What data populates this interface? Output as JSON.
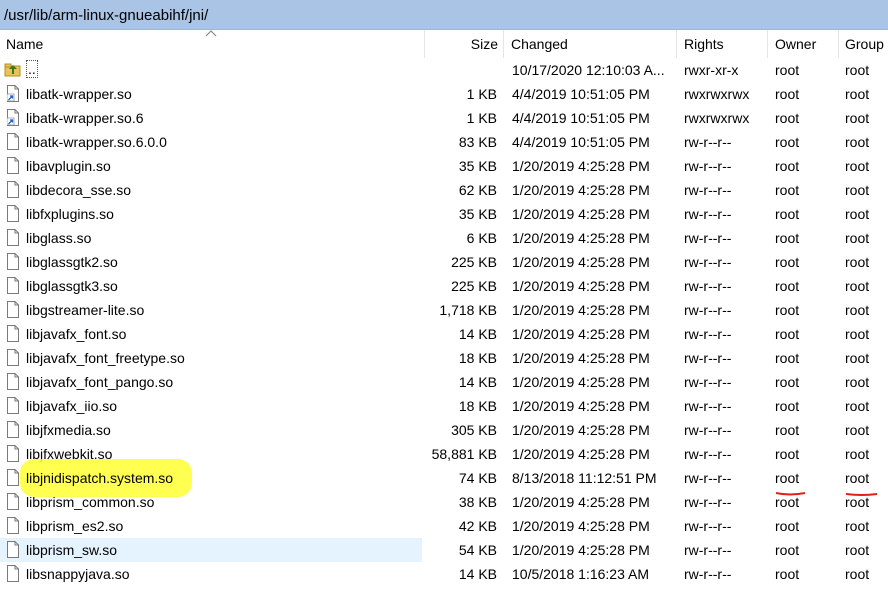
{
  "path": "/usr/lib/arm-linux-gnueabihf/jni/",
  "columns": {
    "name": "Name",
    "size": "Size",
    "changed": "Changed",
    "rights": "Rights",
    "owner": "Owner",
    "group": "Group"
  },
  "files": [
    {
      "name": "..",
      "size": "",
      "changed": "10/17/2020 12:10:03 A...",
      "rights": "rwxr-xr-x",
      "owner": "root",
      "group": "root",
      "icon": "parent-folder-icon"
    },
    {
      "name": "libatk-wrapper.so",
      "size": "1 KB",
      "changed": "4/4/2019 10:51:05 PM",
      "rights": "rwxrwxrwx",
      "owner": "root",
      "group": "root",
      "icon": "symlink-icon"
    },
    {
      "name": "libatk-wrapper.so.6",
      "size": "1 KB",
      "changed": "4/4/2019 10:51:05 PM",
      "rights": "rwxrwxrwx",
      "owner": "root",
      "group": "root",
      "icon": "symlink-icon"
    },
    {
      "name": "libatk-wrapper.so.6.0.0",
      "size": "83 KB",
      "changed": "4/4/2019 10:51:05 PM",
      "rights": "rw-r--r--",
      "owner": "root",
      "group": "root",
      "icon": "file-icon"
    },
    {
      "name": "libavplugin.so",
      "size": "35 KB",
      "changed": "1/20/2019 4:25:28 PM",
      "rights": "rw-r--r--",
      "owner": "root",
      "group": "root",
      "icon": "file-icon"
    },
    {
      "name": "libdecora_sse.so",
      "size": "62 KB",
      "changed": "1/20/2019 4:25:28 PM",
      "rights": "rw-r--r--",
      "owner": "root",
      "group": "root",
      "icon": "file-icon"
    },
    {
      "name": "libfxplugins.so",
      "size": "35 KB",
      "changed": "1/20/2019 4:25:28 PM",
      "rights": "rw-r--r--",
      "owner": "root",
      "group": "root",
      "icon": "file-icon"
    },
    {
      "name": "libglass.so",
      "size": "6 KB",
      "changed": "1/20/2019 4:25:28 PM",
      "rights": "rw-r--r--",
      "owner": "root",
      "group": "root",
      "icon": "file-icon"
    },
    {
      "name": "libglassgtk2.so",
      "size": "225 KB",
      "changed": "1/20/2019 4:25:28 PM",
      "rights": "rw-r--r--",
      "owner": "root",
      "group": "root",
      "icon": "file-icon"
    },
    {
      "name": "libglassgtk3.so",
      "size": "225 KB",
      "changed": "1/20/2019 4:25:28 PM",
      "rights": "rw-r--r--",
      "owner": "root",
      "group": "root",
      "icon": "file-icon"
    },
    {
      "name": "libgstreamer-lite.so",
      "size": "1,718 KB",
      "changed": "1/20/2019 4:25:28 PM",
      "rights": "rw-r--r--",
      "owner": "root",
      "group": "root",
      "icon": "file-icon"
    },
    {
      "name": "libjavafx_font.so",
      "size": "14 KB",
      "changed": "1/20/2019 4:25:28 PM",
      "rights": "rw-r--r--",
      "owner": "root",
      "group": "root",
      "icon": "file-icon"
    },
    {
      "name": "libjavafx_font_freetype.so",
      "size": "18 KB",
      "changed": "1/20/2019 4:25:28 PM",
      "rights": "rw-r--r--",
      "owner": "root",
      "group": "root",
      "icon": "file-icon"
    },
    {
      "name": "libjavafx_font_pango.so",
      "size": "14 KB",
      "changed": "1/20/2019 4:25:28 PM",
      "rights": "rw-r--r--",
      "owner": "root",
      "group": "root",
      "icon": "file-icon"
    },
    {
      "name": "libjavafx_iio.so",
      "size": "18 KB",
      "changed": "1/20/2019 4:25:28 PM",
      "rights": "rw-r--r--",
      "owner": "root",
      "group": "root",
      "icon": "file-icon"
    },
    {
      "name": "libjfxmedia.so",
      "size": "305 KB",
      "changed": "1/20/2019 4:25:28 PM",
      "rights": "rw-r--r--",
      "owner": "root",
      "group": "root",
      "icon": "file-icon"
    },
    {
      "name": "libjfxwebkit.so",
      "size": "58,881 KB",
      "changed": "1/20/2019 4:25:28 PM",
      "rights": "rw-r--r--",
      "owner": "root",
      "group": "root",
      "icon": "file-icon"
    },
    {
      "name": "libjnidispatch.system.so",
      "size": "74 KB",
      "changed": "8/13/2018 11:12:51 PM",
      "rights": "rw-r--r--",
      "owner": "root",
      "group": "root",
      "icon": "file-icon",
      "highlighted": true
    },
    {
      "name": "libprism_common.so",
      "size": "38 KB",
      "changed": "1/20/2019 4:25:28 PM",
      "rights": "rw-r--r--",
      "owner": "root",
      "group": "root",
      "icon": "file-icon"
    },
    {
      "name": "libprism_es2.so",
      "size": "42 KB",
      "changed": "1/20/2019 4:25:28 PM",
      "rights": "rw-r--r--",
      "owner": "root",
      "group": "root",
      "icon": "file-icon"
    },
    {
      "name": "libprism_sw.so",
      "size": "54 KB",
      "changed": "1/20/2019 4:25:28 PM",
      "rights": "rw-r--r--",
      "owner": "root",
      "group": "root",
      "icon": "file-icon",
      "selected": true
    },
    {
      "name": "libsnappyjava.so",
      "size": "14 KB",
      "changed": "10/5/2018 1:16:23 AM",
      "rights": "rw-r--r--",
      "owner": "root",
      "group": "root",
      "icon": "file-icon"
    }
  ],
  "colors": {
    "pathbar": "#a9c4e4",
    "selection": "#e5f3ff",
    "highlight": "#ffff33",
    "underline": "#e0201b"
  }
}
